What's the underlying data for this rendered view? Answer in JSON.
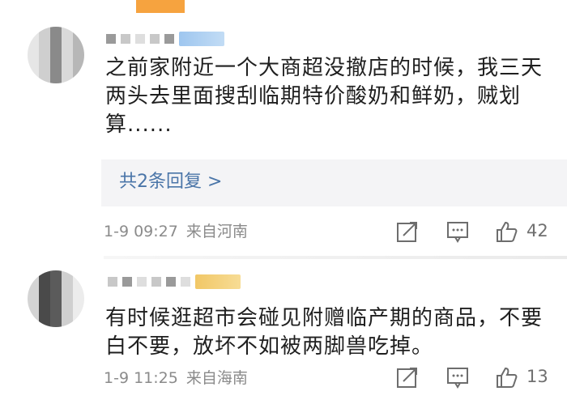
{
  "comments": [
    {
      "text": "之前家附近一个大商超没撤店的时候，我三天两头去里面搜刮临期特价酸奶和鲜奶，贼划算......",
      "replies_label": "共2条回复 >",
      "time": "1-9 09:27",
      "location": "来自河南",
      "likes": "42"
    },
    {
      "text": "有时候逛超市会碰见附赠临产期的商品，不要白不要，放坏不如被两脚兽吃掉。",
      "time": "1-9 11:25",
      "location": "来自海南",
      "likes": "13"
    }
  ],
  "icons": [
    "forward-icon",
    "comment-icon",
    "like-icon"
  ],
  "colors": {
    "text": "#1f1f1f",
    "meta": "#8b8b8b",
    "link": "#4a75a8",
    "reply_bg": "#f4f4f6"
  }
}
